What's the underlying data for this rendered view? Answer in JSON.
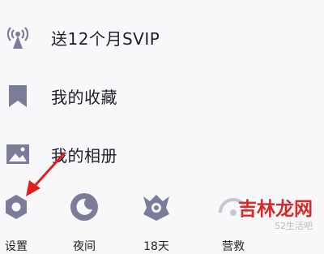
{
  "menu": {
    "items": [
      {
        "label": "送12个月SVIP",
        "icon": "broadcast-icon"
      },
      {
        "label": "我的收藏",
        "icon": "bookmark-icon"
      },
      {
        "label": "我的相册",
        "icon": "image-icon"
      }
    ]
  },
  "bottom": {
    "items": [
      {
        "label": "设置",
        "icon": "settings-icon"
      },
      {
        "label": "夜间",
        "icon": "moon-icon"
      },
      {
        "label": "18天",
        "icon": "badge-icon"
      },
      {
        "label": "营救",
        "icon": "rescue-icon"
      }
    ]
  },
  "watermark": {
    "brand": "吉林龙网",
    "site": "52生活吧"
  },
  "colors": {
    "icon": "#7b7b9a",
    "arrow": "#e02020",
    "text": "#1f1f2a"
  }
}
